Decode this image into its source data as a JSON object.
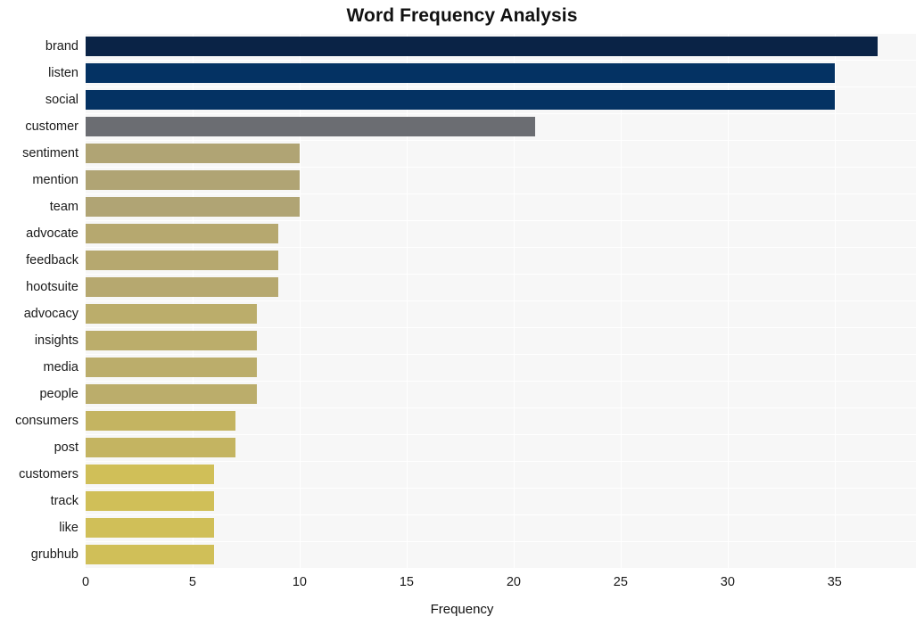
{
  "chart_data": {
    "type": "bar",
    "orientation": "horizontal",
    "title": "Word Frequency Analysis",
    "xlabel": "Frequency",
    "ylabel": "",
    "xlim": [
      0,
      38.8
    ],
    "xticks": [
      0,
      5,
      10,
      15,
      20,
      25,
      30,
      35
    ],
    "xtick_labels": [
      "0",
      "5",
      "10",
      "15",
      "20",
      "25",
      "30",
      "35"
    ],
    "grid": true,
    "legend": null,
    "categories": [
      "brand",
      "listen",
      "social",
      "customer",
      "sentiment",
      "mention",
      "team",
      "advocate",
      "feedback",
      "hootsuite",
      "advocacy",
      "insights",
      "media",
      "people",
      "consumers",
      "post",
      "customers",
      "track",
      "like",
      "grubhub"
    ],
    "values": [
      37,
      35,
      35,
      21,
      10,
      10,
      10,
      9,
      9,
      9,
      8,
      8,
      8,
      8,
      7,
      7,
      6,
      6,
      6,
      6
    ],
    "bar_colors": [
      "#0a2346",
      "#043263",
      "#043263",
      "#6b6d72",
      "#b0a474",
      "#b0a474",
      "#b0a474",
      "#b6a86f",
      "#b6a86f",
      "#b6a86f",
      "#bbad6b",
      "#bbad6b",
      "#bbad6b",
      "#bbad6b",
      "#c4b461",
      "#c4b461",
      "#d0bf58",
      "#d0bf58",
      "#d0bf58",
      "#d0bf58"
    ],
    "plot_background": "#f7f7f7",
    "figure_background": "#ffffff",
    "gridline_color": "#ffffff"
  }
}
